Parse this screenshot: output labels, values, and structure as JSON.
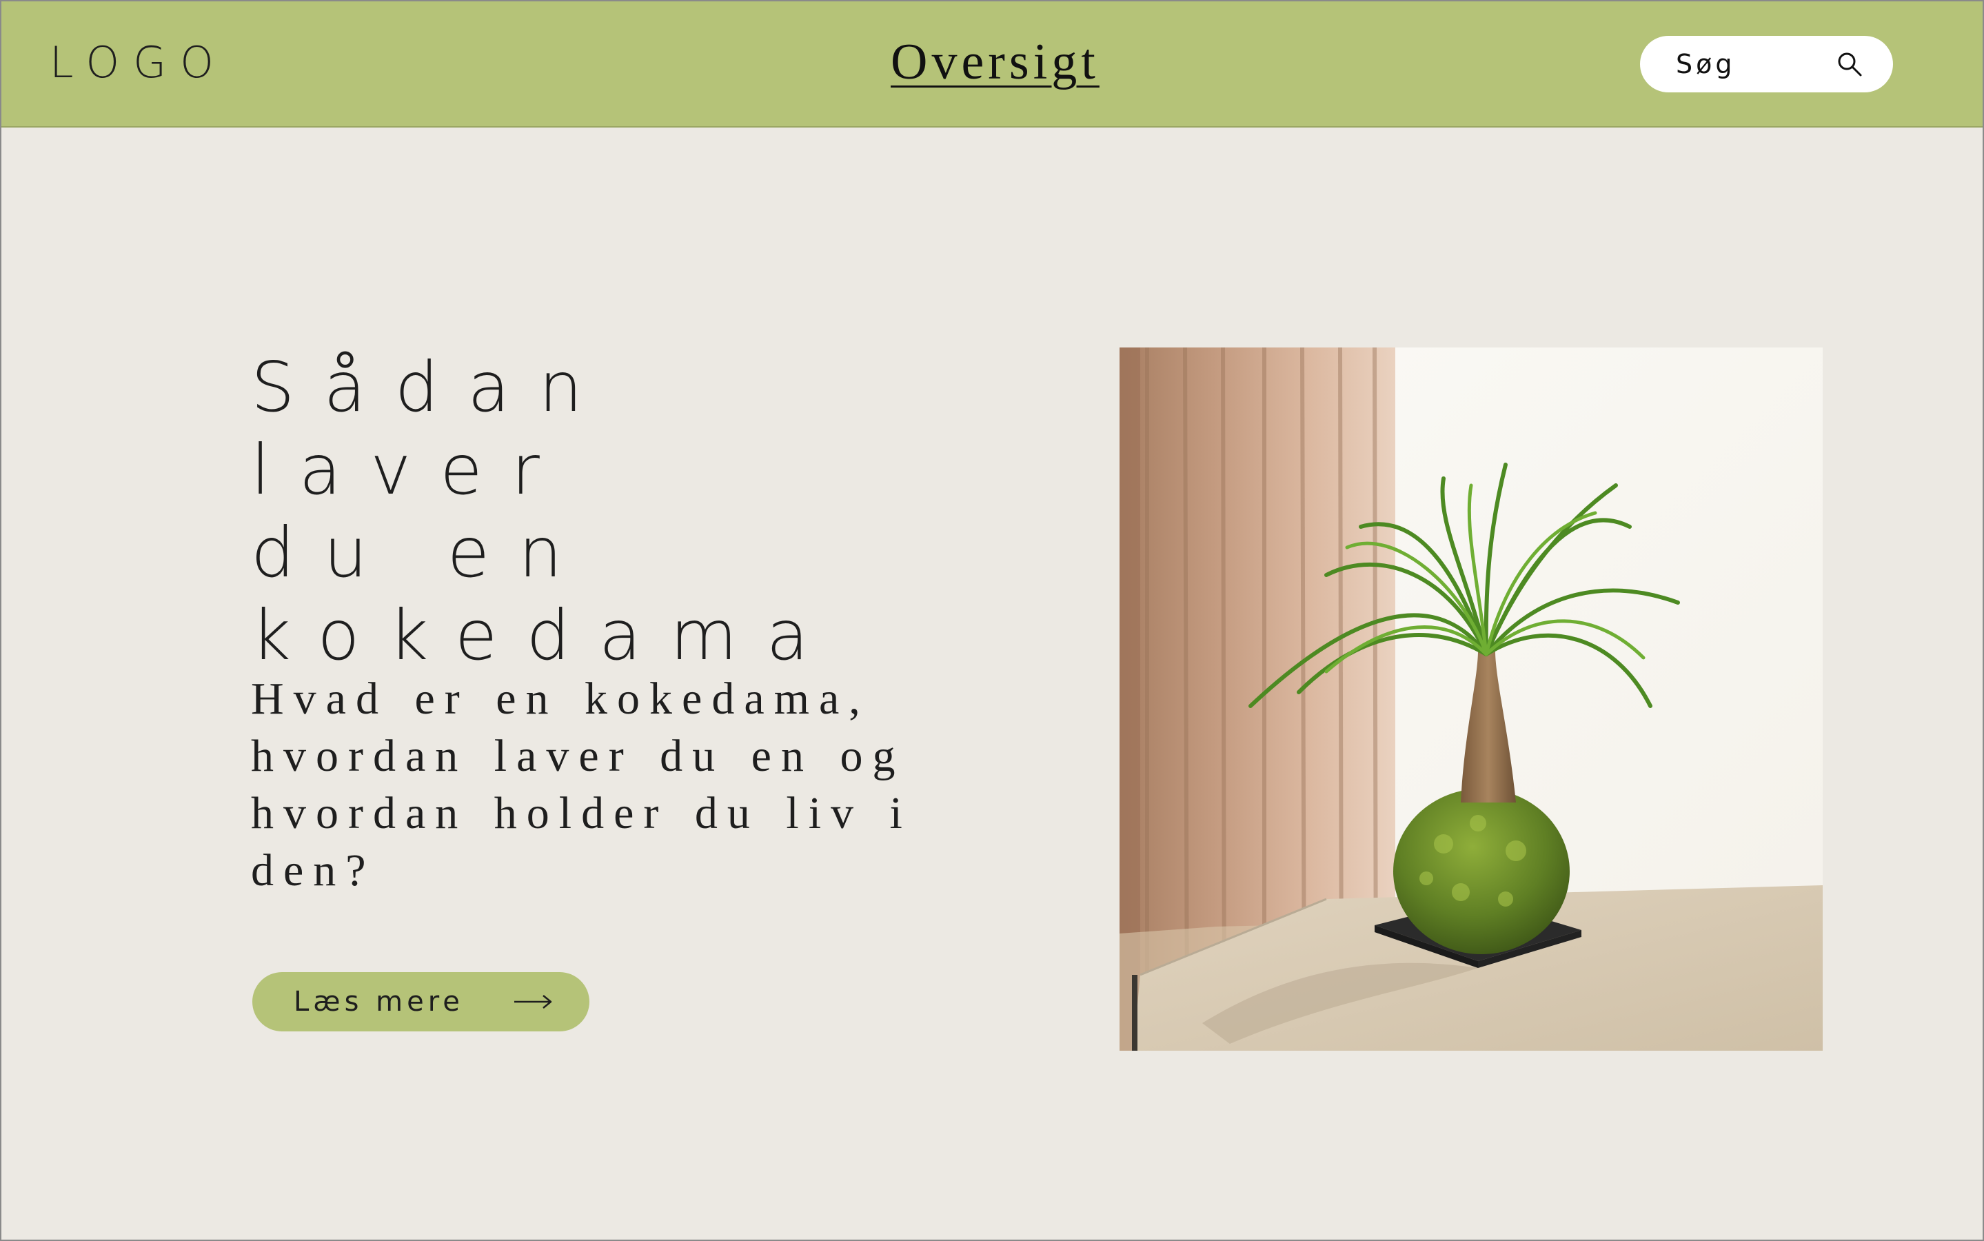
{
  "header": {
    "logo": "LOGO",
    "nav_title": "Oversigt",
    "search": {
      "placeholder": "Søg",
      "icon": "search-icon"
    }
  },
  "hero": {
    "headline_lines": [
      "Sådan laver",
      "du en",
      "kokedama"
    ],
    "subtext_lines": [
      "Hvad er en kokedama,",
      "hvordan laver du en og",
      "hvordan holder du liv i",
      "den?"
    ],
    "cta_label": "Læs mere",
    "cta_icon": "arrow-right-icon",
    "image": "photo of a ponytail palm kokedama moss ball on a table beside a curtain"
  },
  "colors": {
    "accent": "#b5c378",
    "background": "#ece9e3",
    "text": "#1e1e1e"
  }
}
